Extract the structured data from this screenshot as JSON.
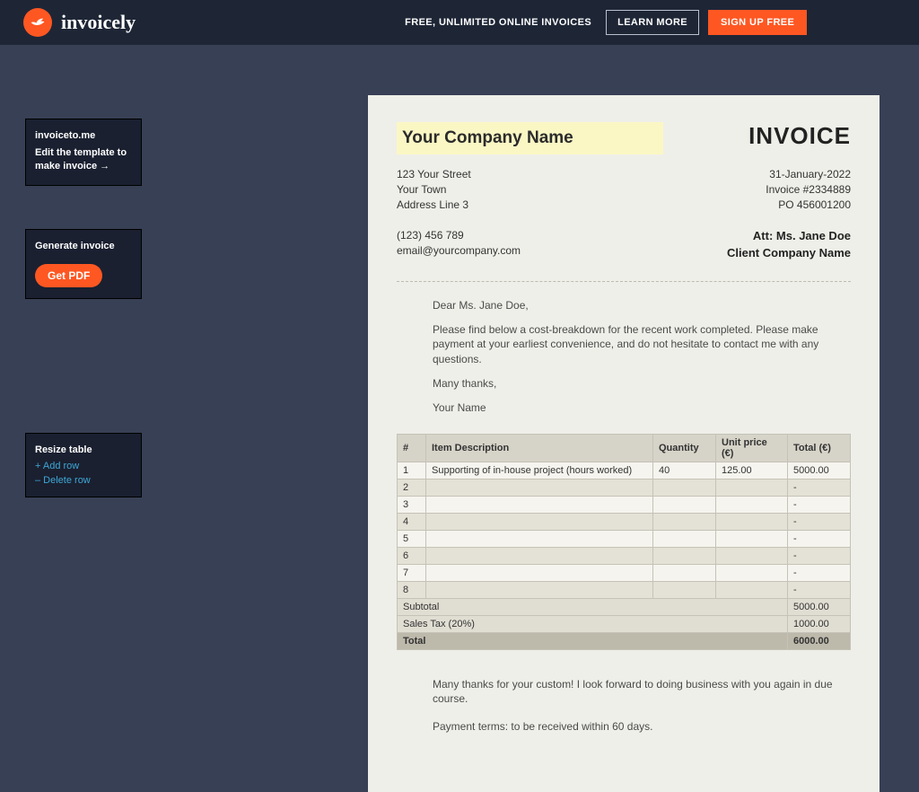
{
  "topbar": {
    "brand": "invoicely",
    "tagline": "FREE, UNLIMITED ONLINE INVOICES",
    "learn_more": "LEARN MORE",
    "signup": "SIGN UP FREE"
  },
  "panel1": {
    "title": "invoiceto.me",
    "sub": "Edit the template to make invoice →"
  },
  "panel2": {
    "title": "Generate invoice",
    "button": "Get PDF"
  },
  "panel3": {
    "title": "Resize table",
    "add": "+  Add row",
    "del": "–  Delete row"
  },
  "invoice": {
    "company_name": "Your Company Name",
    "title": "INVOICE",
    "addr1": "123 Your Street",
    "addr2": "Your Town",
    "addr3": "Address Line 3",
    "date": "31-January-2022",
    "inv_no": "Invoice #2334889",
    "po": "PO 456001200",
    "phone": "(123) 456 789",
    "email": "email@yourcompany.com",
    "att": "Att: Ms. Jane Doe",
    "client_co": "Client Company Name",
    "letter": {
      "greet": "Dear Ms. Jane Doe,",
      "body": "Please find below a cost-breakdown for the recent work completed. Please make payment at your earliest convenience, and do not hesitate to contact me with any questions.",
      "thanks": "Many thanks,",
      "sign": "Your Name"
    },
    "headers": {
      "n": "#",
      "desc": "Item Description",
      "qty": "Quantity",
      "price": "Unit price (€)",
      "total": "Total (€)"
    },
    "rows": [
      {
        "n": "1",
        "desc": "Supporting of in-house project (hours worked)",
        "qty": "40",
        "price": "125.00",
        "total": "5000.00"
      },
      {
        "n": "2",
        "desc": "",
        "qty": "",
        "price": "",
        "total": "-"
      },
      {
        "n": "3",
        "desc": "",
        "qty": "",
        "price": "",
        "total": "-"
      },
      {
        "n": "4",
        "desc": "",
        "qty": "",
        "price": "",
        "total": "-"
      },
      {
        "n": "5",
        "desc": "",
        "qty": "",
        "price": "",
        "total": "-"
      },
      {
        "n": "6",
        "desc": "",
        "qty": "",
        "price": "",
        "total": "-"
      },
      {
        "n": "7",
        "desc": "",
        "qty": "",
        "price": "",
        "total": "-"
      },
      {
        "n": "8",
        "desc": "",
        "qty": "",
        "price": "",
        "total": "-"
      }
    ],
    "subtotal_label": "Subtotal",
    "subtotal": "5000.00",
    "tax_label": "Sales Tax (20%)",
    "tax": "1000.00",
    "total_label": "Total",
    "total": "6000.00",
    "foot1": "Many thanks for your custom! I look forward to doing business with you again in due course.",
    "foot2": "Payment terms: to be received within 60 days."
  }
}
